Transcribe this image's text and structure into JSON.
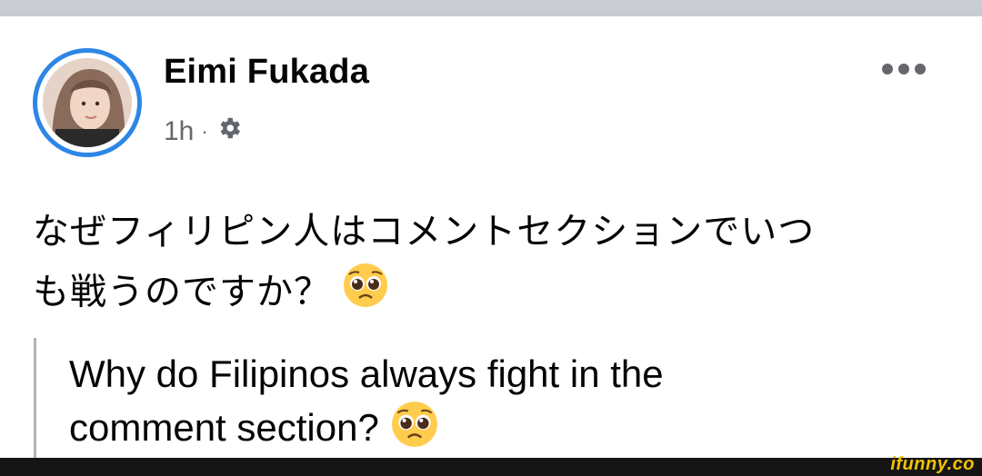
{
  "post": {
    "author": "Eimi Fukada",
    "time": "1h",
    "separator": "·",
    "privacy_icon": "gear-icon",
    "text_jp_line1": "なぜフィリピン人はコメントセクションでいつ",
    "text_jp_line2": "も戦うのですか？",
    "text_en_line1": "Why do Filipinos always fight in the",
    "text_en_line2": "comment section?",
    "emoji": "pleading-face-emoji"
  },
  "watermark": "ifunny.co",
  "colors": {
    "avatar_ring": "#2d86e6",
    "meta_text": "#65676b",
    "watermark": "#f2c200",
    "top_bar": "#c9ccd1",
    "bottom_bar": "#151515"
  }
}
